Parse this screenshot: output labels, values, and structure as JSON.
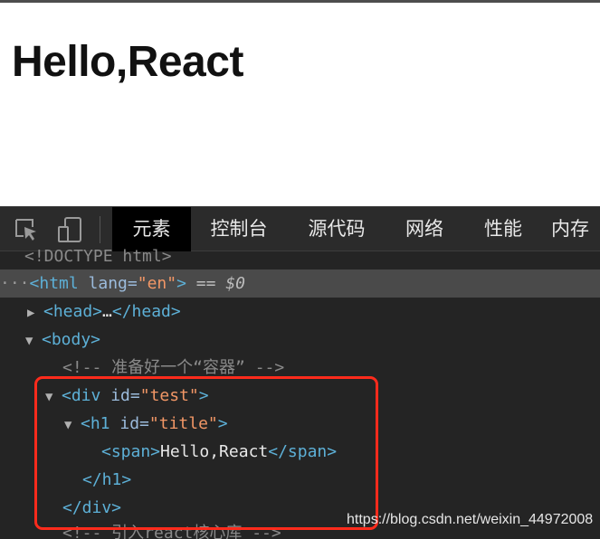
{
  "page": {
    "heading": "Hello,React"
  },
  "devtools": {
    "toolbar": {
      "icons": [
        "inspect-element-icon",
        "device-toolbar-icon"
      ],
      "tabs": [
        {
          "label": "元素",
          "active": true
        },
        {
          "label": "控制台",
          "active": false
        },
        {
          "label": "源代码",
          "active": false
        },
        {
          "label": "网络",
          "active": false
        },
        {
          "label": "性能",
          "active": false
        },
        {
          "label": "内存",
          "active": false
        }
      ]
    },
    "tree": {
      "doctype": "<!DOCTYPE html>",
      "html_row": {
        "dots": "···",
        "open": "<html",
        "attr": "lang",
        "eq": "=",
        "value": "\"en\"",
        "close": ">",
        "marker": "== ",
        "var": "$0"
      },
      "head_row": {
        "open": "<head>",
        "ellipsis": "…",
        "close": "</head>"
      },
      "body_row": {
        "open": "<body>"
      },
      "comment_container": "<!-- 准备好一个“容器” -->",
      "div_row": {
        "open": "<div",
        "attr": "id",
        "eq": "=",
        "value": "\"test\"",
        "close": ">"
      },
      "h1_row": {
        "open": "<h1",
        "attr": "id",
        "eq": "=",
        "value": "\"title\"",
        "close": ">"
      },
      "span_row": {
        "open": "<span>",
        "text": "Hello,React",
        "close": "</span>"
      },
      "h1_close": "</h1>",
      "div_close": "</div>",
      "comment_react": "<!-- 引入react核心库 -->"
    }
  },
  "watermark": "https://blog.csdn.net/weixin_44972008",
  "colors": {
    "tag": "#5db0d7",
    "attr": "#9bbbdc",
    "value": "#f29766",
    "comment": "#8a8a8a",
    "highlight": "#ff2b1c",
    "background": "#242424"
  }
}
